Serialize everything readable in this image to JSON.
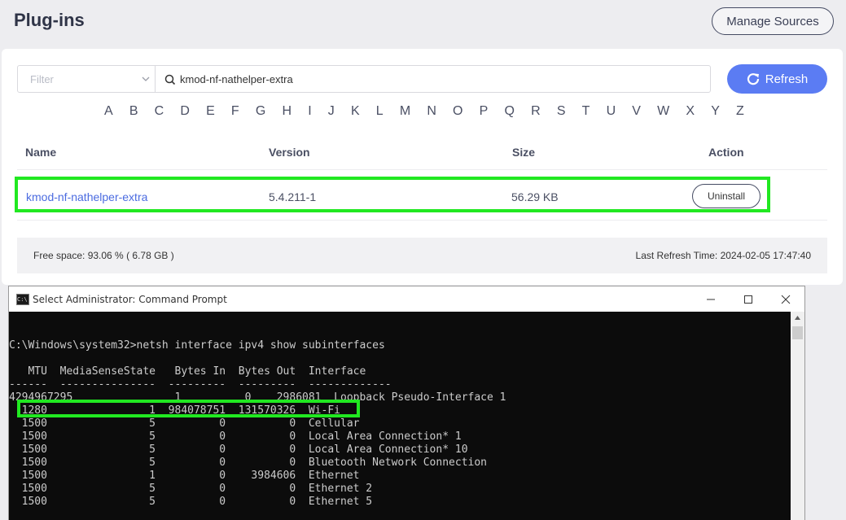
{
  "header": {
    "title": "Plug-ins",
    "manage_sources_label": "Manage Sources"
  },
  "filter": {
    "placeholder": "Filter",
    "search_value": "kmod-nf-nathelper-extra"
  },
  "refresh_label": "Refresh",
  "alphabet": [
    "A",
    "B",
    "C",
    "D",
    "E",
    "F",
    "G",
    "H",
    "I",
    "J",
    "K",
    "L",
    "M",
    "N",
    "O",
    "P",
    "Q",
    "R",
    "S",
    "T",
    "U",
    "V",
    "W",
    "X",
    "Y",
    "Z"
  ],
  "table": {
    "columns": [
      "Name",
      "Version",
      "Size",
      "Action"
    ],
    "rows": [
      {
        "name": "kmod-nf-nathelper-extra",
        "version": "5.4.211-1",
        "size": "56.29 KB",
        "action": "Uninstall"
      }
    ]
  },
  "footer": {
    "free_space": "Free space: 93.06 % ( 6.78 GB )",
    "last_refresh": "Last Refresh Time: 2024-02-05 17:47:40"
  },
  "cmd": {
    "title": "Select Administrator: Command Prompt",
    "icon_label": "C:\\",
    "lines": [
      "C:\\Windows\\system32>netsh interface ipv4 show subinterfaces",
      "",
      "   MTU  MediaSenseState   Bytes In  Bytes Out  Interface",
      "------  ---------------  ---------  ---------  -------------",
      "4294967295                1          0    2986081  Loopback Pseudo-Interface 1",
      "  1280                1  984078751  131570326  Wi-Fi",
      "  1500                5          0          0  Cellular",
      "  1500                5          0          0  Local Area Connection* 1",
      "  1500                5          0          0  Local Area Connection* 10",
      "  1500                5          0          0  Bluetooth Network Connection",
      "  1500                1          0    3984606  Ethernet",
      "  1500                5          0          0  Ethernet 2",
      "  1500                5          0          0  Ethernet 5"
    ]
  },
  "colors": {
    "accent": "#5b7cf3",
    "highlight": "#21e821",
    "link": "#4b6be0",
    "console_bg": "#0c0c0c"
  }
}
